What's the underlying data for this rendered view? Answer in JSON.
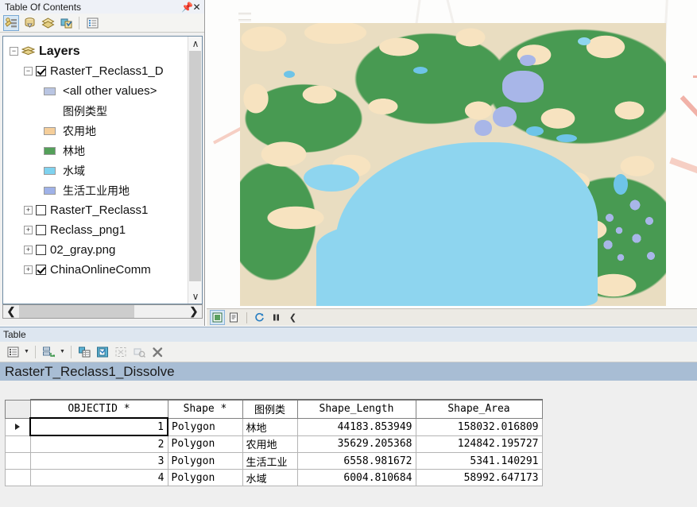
{
  "toc_panel": {
    "title": "Table Of Contents",
    "pin_icon": "pin-icon",
    "close_icon": "close-icon",
    "toolbar": [
      {
        "name": "list-by-drawing-order-button",
        "selected": true
      },
      {
        "name": "list-by-source-button",
        "selected": false
      },
      {
        "name": "list-by-visibility-button",
        "selected": false
      },
      {
        "name": "list-by-selection-button",
        "selected": false
      },
      {
        "name": "options-button",
        "selected": false
      }
    ],
    "tree": {
      "root_label": "Layers",
      "items": [
        {
          "label": "RasterT_Reclass1_D",
          "type": "layer",
          "checked": true,
          "expander": "-",
          "indent": 1
        },
        {
          "label": "<all other values>",
          "type": "symbol",
          "swatch": "#b9c5e2",
          "indent": 2
        },
        {
          "label": "图例类型",
          "type": "heading",
          "indent": 2
        },
        {
          "label": "农用地",
          "type": "symbol",
          "swatch": "#f5ce9a",
          "indent": 2
        },
        {
          "label": "林地",
          "type": "symbol",
          "swatch": "#54a05a",
          "indent": 2
        },
        {
          "label": "水域",
          "type": "symbol",
          "swatch": "#7fd2ef",
          "indent": 2
        },
        {
          "label": "生活工业用地",
          "type": "symbol",
          "swatch": "#9fb2e8",
          "indent": 2
        },
        {
          "label": "RasterT_Reclass1",
          "type": "layer",
          "checked": false,
          "expander": "+",
          "indent": 1
        },
        {
          "label": "Reclass_png1",
          "type": "layer",
          "checked": false,
          "expander": "+",
          "indent": 1
        },
        {
          "label": "02_gray.png",
          "type": "layer",
          "checked": false,
          "expander": "+",
          "indent": 1
        },
        {
          "label": "ChinaOnlineComm",
          "type": "layer",
          "checked": true,
          "expander": "+",
          "indent": 1
        }
      ]
    },
    "scroll": {
      "up_arrow": "∧",
      "down_arrow": "∨",
      "left_arrow": "❮",
      "right_arrow": "❯"
    }
  },
  "map": {
    "toolbar": [
      {
        "name": "data-view-button",
        "selected": true
      },
      {
        "name": "layout-view-button",
        "selected": false
      },
      {
        "name": "refresh-button",
        "selected": false
      },
      {
        "name": "pause-drawing-button",
        "selected": false
      },
      {
        "name": "collapse-button",
        "selected": false
      }
    ],
    "colors": {
      "farmland": "#f7e3c0",
      "forest": "#489a52",
      "water": "#8ed5ef",
      "urban": "#a8b6e8",
      "road_pink": "#eeae9f",
      "road_white": "#f3f1ee",
      "background": "#fdfdfc"
    }
  },
  "table_panel": {
    "title": "Table",
    "toolbar": [
      {
        "name": "table-options-button"
      },
      {
        "name": "table-options-dropdown"
      },
      {
        "name": "related-tables-button"
      },
      {
        "name": "related-tables-dropdown"
      },
      {
        "name": "select-by-attributes-button"
      },
      {
        "name": "switch-selection-button"
      },
      {
        "name": "zoom-to-selected-button"
      },
      {
        "name": "clear-selection-button"
      },
      {
        "name": "delete-selected-button"
      }
    ],
    "tab_label": "RasterT_Reclass1_Dissolve",
    "columns": [
      "OBJECTID *",
      "Shape *",
      "图例类",
      "Shape_Length",
      "Shape_Area"
    ],
    "rows": [
      {
        "objectid": "1",
        "shape": "Polygon",
        "type": "林地",
        "length": "44183.853949",
        "area": "158032.016809",
        "selected": true
      },
      {
        "objectid": "2",
        "shape": "Polygon",
        "type": "农用地",
        "length": "35629.205368",
        "area": "124842.195727",
        "selected": false
      },
      {
        "objectid": "3",
        "shape": "Polygon",
        "type": "生活工业",
        "length": "6558.981672",
        "area": "5341.140291",
        "selected": false
      },
      {
        "objectid": "4",
        "shape": "Polygon",
        "type": "水域",
        "length": "6004.810684",
        "area": "58992.647173",
        "selected": false
      }
    ]
  }
}
